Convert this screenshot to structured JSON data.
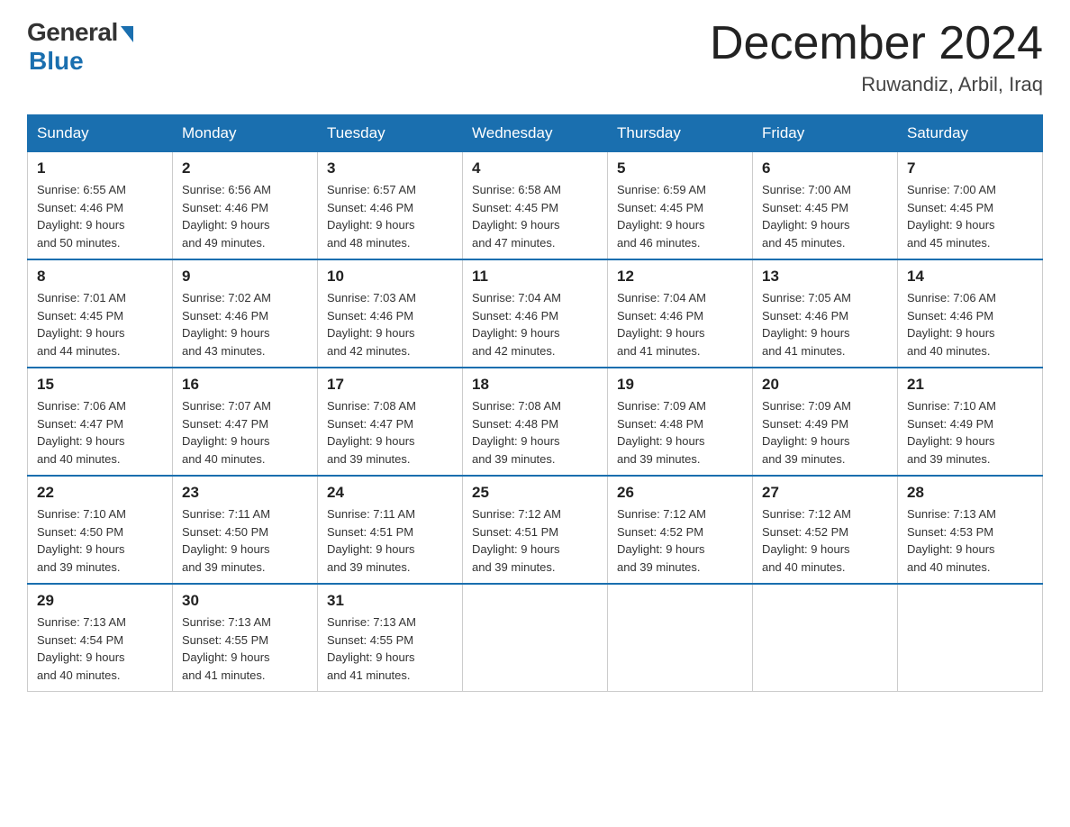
{
  "header": {
    "logo_general": "General",
    "logo_blue": "Blue",
    "title": "December 2024",
    "location": "Ruwandiz, Arbil, Iraq"
  },
  "weekdays": [
    "Sunday",
    "Monday",
    "Tuesday",
    "Wednesday",
    "Thursday",
    "Friday",
    "Saturday"
  ],
  "weeks": [
    [
      {
        "day": "1",
        "sunrise": "6:55 AM",
        "sunset": "4:46 PM",
        "daylight": "9 hours and 50 minutes."
      },
      {
        "day": "2",
        "sunrise": "6:56 AM",
        "sunset": "4:46 PM",
        "daylight": "9 hours and 49 minutes."
      },
      {
        "day": "3",
        "sunrise": "6:57 AM",
        "sunset": "4:46 PM",
        "daylight": "9 hours and 48 minutes."
      },
      {
        "day": "4",
        "sunrise": "6:58 AM",
        "sunset": "4:45 PM",
        "daylight": "9 hours and 47 minutes."
      },
      {
        "day": "5",
        "sunrise": "6:59 AM",
        "sunset": "4:45 PM",
        "daylight": "9 hours and 46 minutes."
      },
      {
        "day": "6",
        "sunrise": "7:00 AM",
        "sunset": "4:45 PM",
        "daylight": "9 hours and 45 minutes."
      },
      {
        "day": "7",
        "sunrise": "7:00 AM",
        "sunset": "4:45 PM",
        "daylight": "9 hours and 45 minutes."
      }
    ],
    [
      {
        "day": "8",
        "sunrise": "7:01 AM",
        "sunset": "4:45 PM",
        "daylight": "9 hours and 44 minutes."
      },
      {
        "day": "9",
        "sunrise": "7:02 AM",
        "sunset": "4:46 PM",
        "daylight": "9 hours and 43 minutes."
      },
      {
        "day": "10",
        "sunrise": "7:03 AM",
        "sunset": "4:46 PM",
        "daylight": "9 hours and 42 minutes."
      },
      {
        "day": "11",
        "sunrise": "7:04 AM",
        "sunset": "4:46 PM",
        "daylight": "9 hours and 42 minutes."
      },
      {
        "day": "12",
        "sunrise": "7:04 AM",
        "sunset": "4:46 PM",
        "daylight": "9 hours and 41 minutes."
      },
      {
        "day": "13",
        "sunrise": "7:05 AM",
        "sunset": "4:46 PM",
        "daylight": "9 hours and 41 minutes."
      },
      {
        "day": "14",
        "sunrise": "7:06 AM",
        "sunset": "4:46 PM",
        "daylight": "9 hours and 40 minutes."
      }
    ],
    [
      {
        "day": "15",
        "sunrise": "7:06 AM",
        "sunset": "4:47 PM",
        "daylight": "9 hours and 40 minutes."
      },
      {
        "day": "16",
        "sunrise": "7:07 AM",
        "sunset": "4:47 PM",
        "daylight": "9 hours and 40 minutes."
      },
      {
        "day": "17",
        "sunrise": "7:08 AM",
        "sunset": "4:47 PM",
        "daylight": "9 hours and 39 minutes."
      },
      {
        "day": "18",
        "sunrise": "7:08 AM",
        "sunset": "4:48 PM",
        "daylight": "9 hours and 39 minutes."
      },
      {
        "day": "19",
        "sunrise": "7:09 AM",
        "sunset": "4:48 PM",
        "daylight": "9 hours and 39 minutes."
      },
      {
        "day": "20",
        "sunrise": "7:09 AM",
        "sunset": "4:49 PM",
        "daylight": "9 hours and 39 minutes."
      },
      {
        "day": "21",
        "sunrise": "7:10 AM",
        "sunset": "4:49 PM",
        "daylight": "9 hours and 39 minutes."
      }
    ],
    [
      {
        "day": "22",
        "sunrise": "7:10 AM",
        "sunset": "4:50 PM",
        "daylight": "9 hours and 39 minutes."
      },
      {
        "day": "23",
        "sunrise": "7:11 AM",
        "sunset": "4:50 PM",
        "daylight": "9 hours and 39 minutes."
      },
      {
        "day": "24",
        "sunrise": "7:11 AM",
        "sunset": "4:51 PM",
        "daylight": "9 hours and 39 minutes."
      },
      {
        "day": "25",
        "sunrise": "7:12 AM",
        "sunset": "4:51 PM",
        "daylight": "9 hours and 39 minutes."
      },
      {
        "day": "26",
        "sunrise": "7:12 AM",
        "sunset": "4:52 PM",
        "daylight": "9 hours and 39 minutes."
      },
      {
        "day": "27",
        "sunrise": "7:12 AM",
        "sunset": "4:52 PM",
        "daylight": "9 hours and 40 minutes."
      },
      {
        "day": "28",
        "sunrise": "7:13 AM",
        "sunset": "4:53 PM",
        "daylight": "9 hours and 40 minutes."
      }
    ],
    [
      {
        "day": "29",
        "sunrise": "7:13 AM",
        "sunset": "4:54 PM",
        "daylight": "9 hours and 40 minutes."
      },
      {
        "day": "30",
        "sunrise": "7:13 AM",
        "sunset": "4:55 PM",
        "daylight": "9 hours and 41 minutes."
      },
      {
        "day": "31",
        "sunrise": "7:13 AM",
        "sunset": "4:55 PM",
        "daylight": "9 hours and 41 minutes."
      },
      null,
      null,
      null,
      null
    ]
  ],
  "labels": {
    "sunrise": "Sunrise:",
    "sunset": "Sunset:",
    "daylight": "Daylight:"
  }
}
